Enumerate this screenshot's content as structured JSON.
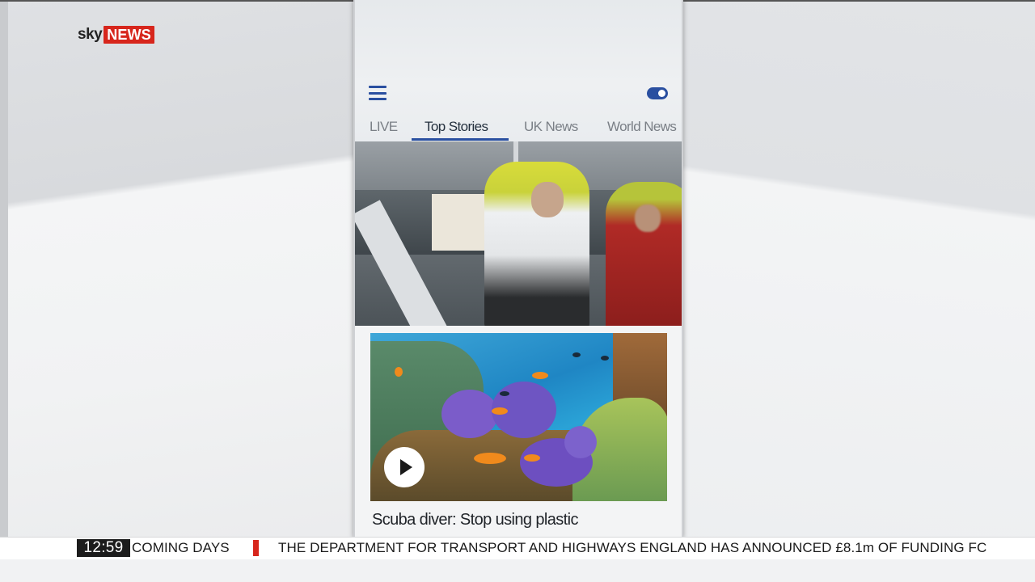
{
  "broadcast": {
    "logo": {
      "sky": "sky",
      "news": "NEWS"
    },
    "clock": "12:59",
    "ticker_left": "COMING DAYS",
    "ticker_main": "THE DEPARTMENT FOR TRANSPORT AND HIGHWAYS ENGLAND HAS ANNOUNCED £8.1m OF FUNDING FC",
    "accent_color": "#d7261c"
  },
  "app": {
    "menu_icon": "hamburger-menu-icon",
    "toggle_icon": "toggle-switch-icon",
    "brand_color": "#2a4fa0",
    "tabs": [
      {
        "label": "LIVE",
        "active": false
      },
      {
        "label": "Top Stories",
        "active": true
      },
      {
        "label": "UK News",
        "active": false
      },
      {
        "label": "World News",
        "active": false
      }
    ],
    "story": {
      "title": "Scuba diver: Stop using plastic",
      "media_icon": "play-icon"
    }
  }
}
